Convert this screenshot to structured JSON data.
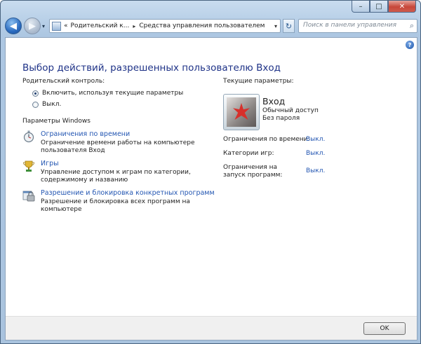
{
  "window": {
    "caption_minimize": "–",
    "caption_maximize": "□",
    "caption_close": "✕"
  },
  "nav": {
    "back_icon": "◀",
    "forward_icon": "▶",
    "dropdown_icon": "▾",
    "address": {
      "prefix": "«",
      "crumbs": [
        "Родительский к...",
        "Средства управления пользователем"
      ],
      "separator": "▸",
      "dropdown_icon": "▾"
    },
    "refresh_icon": "↻",
    "search": {
      "placeholder": "Поиск в панели управления",
      "value": "",
      "icon": "⌕"
    }
  },
  "help_icon": "?",
  "page_title": "Выбор действий, разрешенных пользователю Вход",
  "parental": {
    "heading": "Родительский контроль:",
    "options": [
      {
        "label": "Включить, используя текущие параметры",
        "selected": true
      },
      {
        "label": "Выкл.",
        "selected": false
      }
    ]
  },
  "windows_settings": {
    "heading": "Параметры Windows",
    "items": [
      {
        "icon": "stopwatch-icon",
        "link": "Ограничения по времени",
        "desc": "Ограничение времени работы на компьютере пользователя Вход"
      },
      {
        "icon": "games-trophy-icon",
        "link": "Игры",
        "desc": "Управление доступом к играм по категории, содержимому и названию"
      },
      {
        "icon": "program-blocker-icon",
        "link": "Разрешение и блокировка конкретных программ",
        "desc": "Разрешение и блокировка всех программ на компьютере"
      }
    ]
  },
  "current": {
    "heading": "Текущие параметры:",
    "account_name": "Вход",
    "account_type": "Обычный доступ",
    "password_status": "Без пароля",
    "rows": [
      {
        "key": "Ограничения по времени:",
        "value": "Выкл."
      },
      {
        "key": "Категории игр:",
        "value": "Выкл."
      },
      {
        "key": "Ограничения на запуск программ:",
        "value": "Выкл."
      }
    ]
  },
  "footer": {
    "ok_label": "OK"
  }
}
